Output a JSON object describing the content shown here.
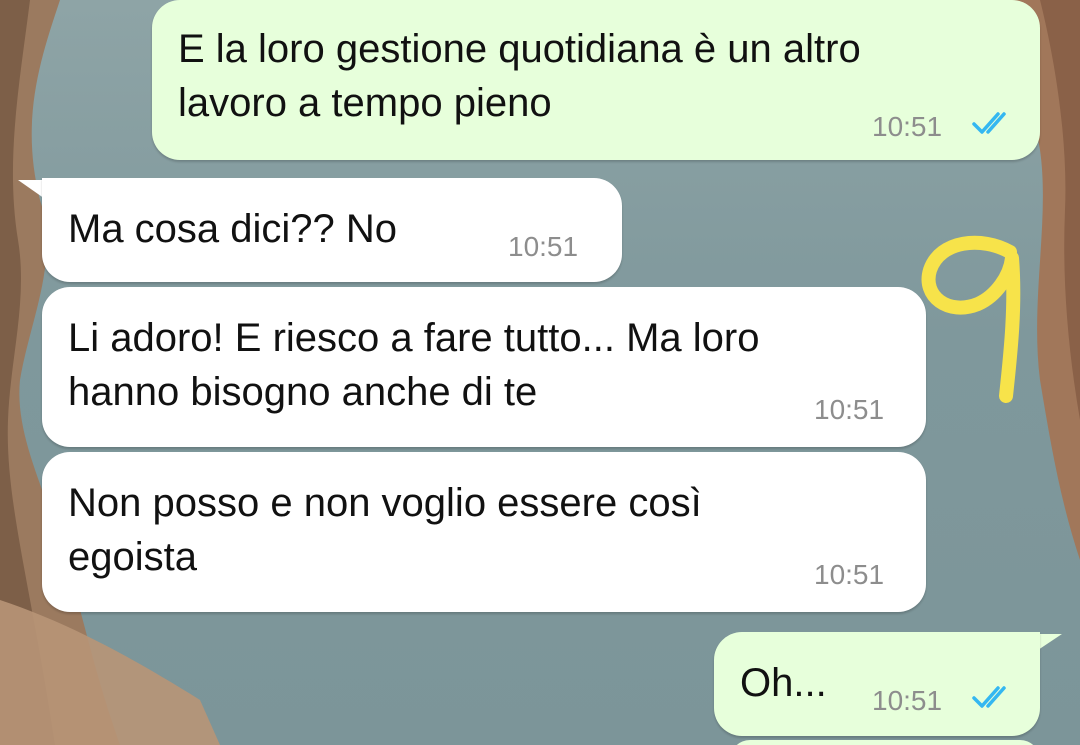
{
  "colors": {
    "outgoing_bubble": "#e7ffdb",
    "incoming_bubble": "#ffffff",
    "timestamp": "#8d8d8d",
    "read_ticks": "#34b7f1",
    "annotation": "#f7e34a"
  },
  "messages": [
    {
      "direction": "outgoing",
      "text": "E la loro gestione quotidiana è un altro\nlavoro a tempo pieno",
      "time": "10:51",
      "status": "read"
    },
    {
      "direction": "incoming",
      "text": "Ma cosa dici?? No",
      "time": "10:51"
    },
    {
      "direction": "incoming",
      "text": "Li adoro! E riesco a fare tutto... Ma loro\nhanno bisogno anche di te",
      "time": "10:51"
    },
    {
      "direction": "incoming",
      "text": "Non posso e non voglio essere così\negoista",
      "time": "10:51"
    },
    {
      "direction": "outgoing",
      "text": "Oh...",
      "time": "10:51",
      "status": "read"
    }
  ],
  "annotation": {
    "glyph": "9",
    "kind": "handwritten-marker"
  },
  "icons": {
    "read_receipt": "double-check-icon"
  }
}
